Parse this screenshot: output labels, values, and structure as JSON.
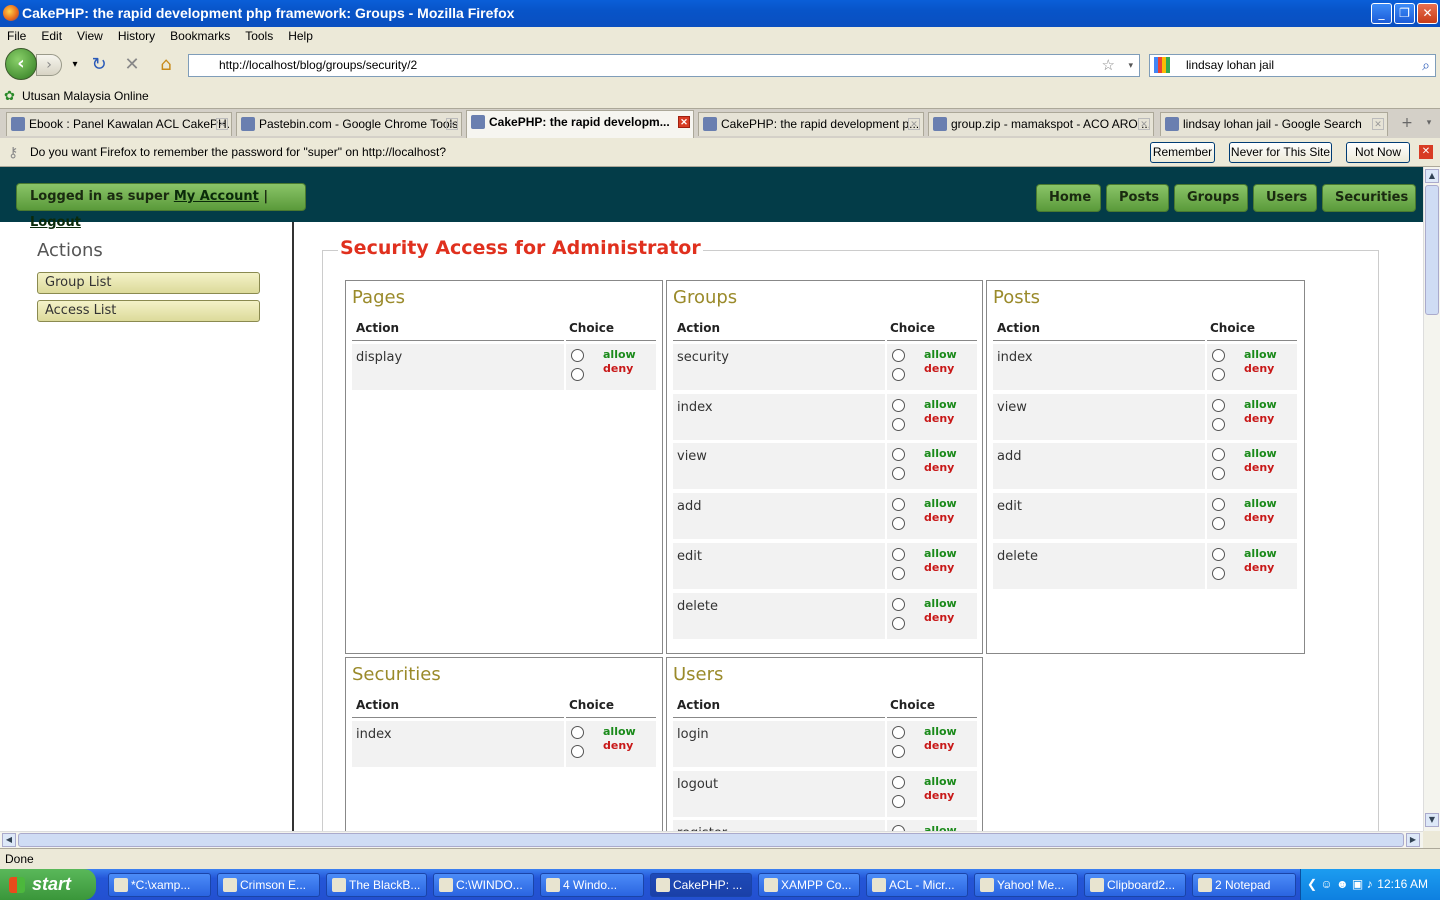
{
  "window": {
    "title": "CakePHP: the rapid development php framework: Groups - Mozilla Firefox"
  },
  "menu": [
    "File",
    "Edit",
    "View",
    "History",
    "Bookmarks",
    "Tools",
    "Help"
  ],
  "nav": {
    "url": "http://localhost/blog/groups/security/2",
    "search": "lindsay lohan jail"
  },
  "bookmark": "Utusan Malaysia Online",
  "tabs": [
    {
      "label": "Ebook : Panel Kawalan ACL CakePH..."
    },
    {
      "label": "Pastebin.com - Google Chrome Tools"
    },
    {
      "label": "CakePHP: the rapid developm..."
    },
    {
      "label": "CakePHP: the rapid development p..."
    },
    {
      "label": "group.zip - mamakspot - ACO ARO ..."
    },
    {
      "label": "lindsay lohan jail - Google Search"
    }
  ],
  "password_bar": {
    "message": "Do you want Firefox to remember the password for \"super\" on http://localhost?",
    "remember": "Remember",
    "never": "Never for This Site",
    "not_now": "Not Now"
  },
  "site": {
    "logged_in": "Logged in as super",
    "my_account": "My Account",
    "separator": "|",
    "logout": "Logout",
    "nav": [
      "Home",
      "Posts",
      "Groups",
      "Users",
      "Securities"
    ]
  },
  "sidebar": {
    "heading": "Actions",
    "items": [
      "Group List",
      "Access List"
    ]
  },
  "page": {
    "title": "Security Access for Administrator",
    "col_action": "Action",
    "col_choice": "Choice",
    "allow": "allow",
    "deny": "deny"
  },
  "panels": {
    "pages": {
      "title": "Pages",
      "actions": [
        "display"
      ]
    },
    "groups": {
      "title": "Groups",
      "actions": [
        "security",
        "index",
        "view",
        "add",
        "edit",
        "delete"
      ]
    },
    "posts": {
      "title": "Posts",
      "actions": [
        "index",
        "view",
        "add",
        "edit",
        "delete"
      ]
    },
    "securities": {
      "title": "Securities",
      "actions": [
        "index"
      ]
    },
    "users": {
      "title": "Users",
      "actions": [
        "login",
        "logout",
        "register"
      ]
    }
  },
  "status": "Done",
  "taskbar": {
    "start": "start",
    "tasks": [
      "*C:\\xamp...",
      "Crimson E...",
      "The BlackB...",
      "C:\\WINDO...",
      "4 Windo...",
      "CakePHP: ...",
      "XAMPP Co...",
      "ACL - Micr...",
      "Yahoo! Me...",
      "Clipboard2...",
      "2 Notepad"
    ],
    "clock": "12:16 AM"
  }
}
